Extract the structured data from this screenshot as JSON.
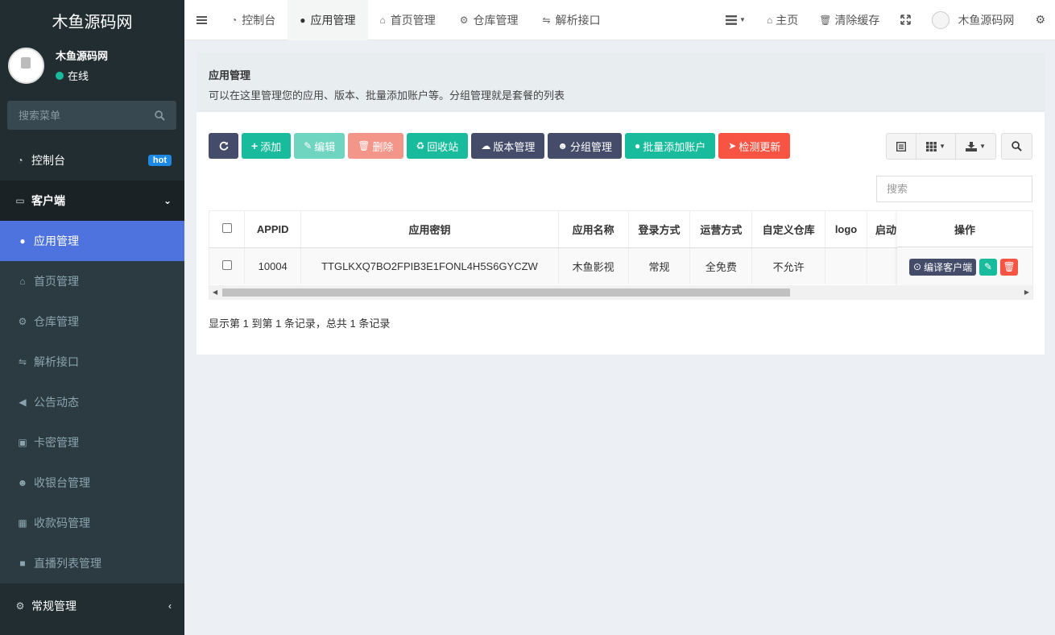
{
  "brand": {
    "title": "木鱼源码网"
  },
  "user": {
    "name": "木鱼源码网",
    "status": "在线"
  },
  "sidebar": {
    "search_placeholder": "搜索菜单",
    "items": [
      {
        "label": "控制台",
        "icon": "dashboard-icon",
        "badge": "hot"
      },
      {
        "label": "客户端",
        "icon": "inbox-icon"
      },
      {
        "label": "应用管理",
        "icon": "android-icon"
      },
      {
        "label": "首页管理",
        "icon": "home-icon"
      },
      {
        "label": "仓库管理",
        "icon": "cogs-icon"
      },
      {
        "label": "解析接口",
        "icon": "usb-icon"
      },
      {
        "label": "公告动态",
        "icon": "bullhorn-icon"
      },
      {
        "label": "卡密管理",
        "icon": "id-card-icon"
      },
      {
        "label": "收银台管理",
        "icon": "user-plus-icon"
      },
      {
        "label": "收款码管理",
        "icon": "qrcode-icon"
      },
      {
        "label": "直播列表管理",
        "icon": "video-icon"
      },
      {
        "label": "常规管理",
        "icon": "cogs-icon"
      }
    ]
  },
  "topbar": {
    "tabs": [
      {
        "label": "控制台",
        "icon": "dashboard-icon"
      },
      {
        "label": "应用管理",
        "icon": "android-icon"
      },
      {
        "label": "首页管理",
        "icon": "home-icon"
      },
      {
        "label": "仓库管理",
        "icon": "cogs-icon"
      },
      {
        "label": "解析接口",
        "icon": "usb-icon"
      }
    ],
    "home_label": "主页",
    "clear_cache_label": "清除缓存",
    "username": "木鱼源码网"
  },
  "panel": {
    "title": "应用管理",
    "description": "可以在这里管理您的应用、版本、批量添加账户等。分组管理就是套餐的列表"
  },
  "toolbar": {
    "add": "添加",
    "edit": "编辑",
    "delete": "删除",
    "recycle": "回收站",
    "version": "版本管理",
    "group": "分组管理",
    "batch_add": "批量添加账户",
    "check_update": "检测更新"
  },
  "table": {
    "search_placeholder": "搜索",
    "columns": [
      "APPID",
      "应用密钥",
      "应用名称",
      "登录方式",
      "运营方式",
      "自定义仓库",
      "logo",
      "启动"
    ],
    "ops_header": "操作",
    "rows": [
      {
        "appid": "10004",
        "key": "TTGLKXQ7BO2FPIB3E1FONL4H5S6GYCZW",
        "name": "木鱼影视",
        "login": "常规",
        "operation": "全免费",
        "custom_repo": "不允许",
        "logo": "",
        "startup": ""
      }
    ],
    "compile_label": "编译客户端",
    "footer": "显示第 1 到第 1 条记录，总共 1 条记录"
  }
}
